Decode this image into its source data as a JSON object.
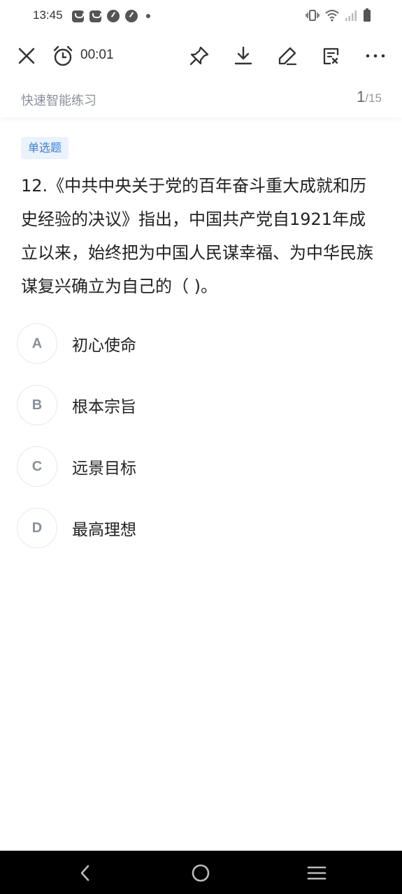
{
  "status_bar": {
    "time": "13:45",
    "icons": [
      "notification-bag-icon",
      "notification-bag-icon",
      "notification-gauge-icon",
      "notification-gauge-icon",
      "more-dot-icon",
      "vibrate-icon",
      "wifi-icon",
      "signal-icon",
      "battery-icon"
    ]
  },
  "toolbar": {
    "timer": "00:01",
    "icons": [
      "close-icon",
      "alarm-clock-icon",
      "pin-icon",
      "download-icon",
      "edit-icon",
      "note-icon",
      "more-icon"
    ]
  },
  "header": {
    "title": "快速智能练习",
    "current": "1",
    "total": "/15"
  },
  "question": {
    "type_label": "单选题",
    "text": "12.《中共中央关于党的百年奋斗重大成就和历史经验的决议》指出，中国共产党自1921年成立以来，始终把为中国人民谋幸福、为中华民族谋复兴确立为自己的（  )。"
  },
  "options": [
    {
      "letter": "A",
      "text": "初心使命"
    },
    {
      "letter": "B",
      "text": "根本宗旨"
    },
    {
      "letter": "C",
      "text": "远景目标"
    },
    {
      "letter": "D",
      "text": "最高理想"
    }
  ],
  "colors": {
    "accent": "#3a7fd5",
    "tag_bg": "#eaf2fc",
    "muted": "#8a8f99",
    "navbar": "#000000"
  }
}
